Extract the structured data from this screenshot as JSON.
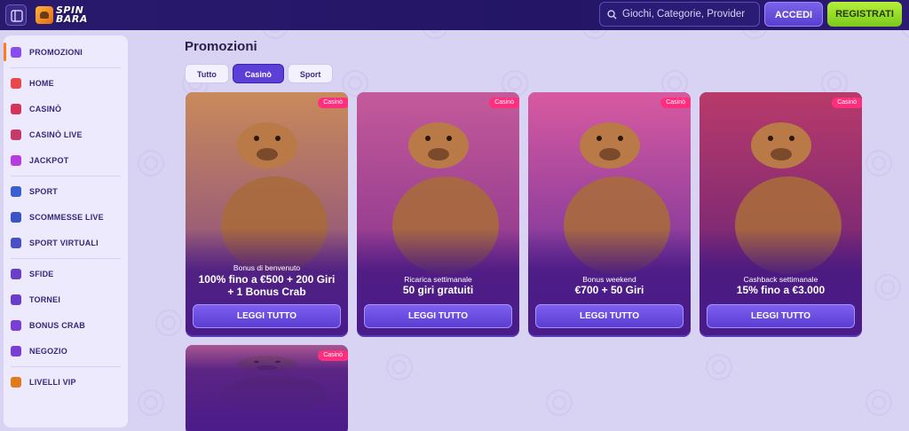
{
  "header": {
    "logo_line1": "SPIN",
    "logo_line2": "BARA",
    "search_placeholder": "Giochi, Categorie, Provider",
    "login_label": "ACCEDI",
    "register_label": "REGISTRATI"
  },
  "sidebar": {
    "items": [
      {
        "label": "PROMOZIONI",
        "icon": "gift-icon",
        "color": "#8a4cf0",
        "active": true
      },
      {
        "label": "HOME",
        "icon": "home-icon",
        "color": "#e8484a"
      },
      {
        "label": "CASINÒ",
        "icon": "cards-icon",
        "color": "#d4345a"
      },
      {
        "label": "CASINÒ LIVE",
        "icon": "roulette-icon",
        "color": "#c53a6a"
      },
      {
        "label": "JACKPOT",
        "icon": "dice-icon",
        "color": "#b53ce0"
      },
      {
        "label": "SPORT",
        "icon": "ball-icon",
        "color": "#3a5fd0"
      },
      {
        "label": "SCOMMESSE LIVE",
        "icon": "tv-icon",
        "color": "#3a54c8"
      },
      {
        "label": "SPORT VIRTUALI",
        "icon": "monitor-icon",
        "color": "#4a4fc4"
      },
      {
        "label": "SFIDE",
        "icon": "target-icon",
        "color": "#6a3ec8"
      },
      {
        "label": "TORNEI",
        "icon": "trophy-icon",
        "color": "#6a3ec8"
      },
      {
        "label": "BONUS CRAB",
        "icon": "crab-icon",
        "color": "#7a3ed8"
      },
      {
        "label": "NEGOZIO",
        "icon": "coin-icon",
        "color": "#7a3ed8"
      },
      {
        "label": "LIVELLI VIP",
        "icon": "crown-icon",
        "color": "#e07a1a"
      }
    ]
  },
  "main": {
    "title": "Promozioni",
    "tabs": [
      {
        "label": "Tutto",
        "active": false
      },
      {
        "label": "Casinò",
        "active": true
      },
      {
        "label": "Sport",
        "active": false
      }
    ],
    "cards": [
      {
        "badge": "Casinò",
        "subtitle": "Bonus di benvenuto",
        "title_line1": "100% fino a €500 + 200 Giri",
        "title_line2": "+ 1 Bonus Crab",
        "button": "LEGGI TUTTO",
        "art_top": "#c98a5a",
        "art_bottom": "#7a3f8a"
      },
      {
        "badge": "Casinò",
        "subtitle": "Ricarica settimanale",
        "title_line1": "50 giri gratuiti",
        "title_line2": "",
        "button": "LEGGI TUTTO",
        "art_top": "#c45a9a",
        "art_bottom": "#7a2a8a"
      },
      {
        "badge": "Casinò",
        "subtitle": "Bonus weekend",
        "title_line1": "€700 + 50 Giri",
        "title_line2": "",
        "button": "LEGGI TUTTO",
        "art_top": "#d85aa0",
        "art_bottom": "#5a2a9a"
      },
      {
        "badge": "Casinò",
        "subtitle": "Cashback settimanale",
        "title_line1": "15% fino a €3.000",
        "title_line2": "",
        "button": "LEGGI TUTTO",
        "art_top": "#b83a6a",
        "art_bottom": "#5a1f7a"
      },
      {
        "badge": "Casinò",
        "subtitle": "",
        "title_line1": "",
        "title_line2": "",
        "button": "",
        "art_top": "#e07a9a",
        "art_bottom": "#c84a7a"
      }
    ]
  }
}
